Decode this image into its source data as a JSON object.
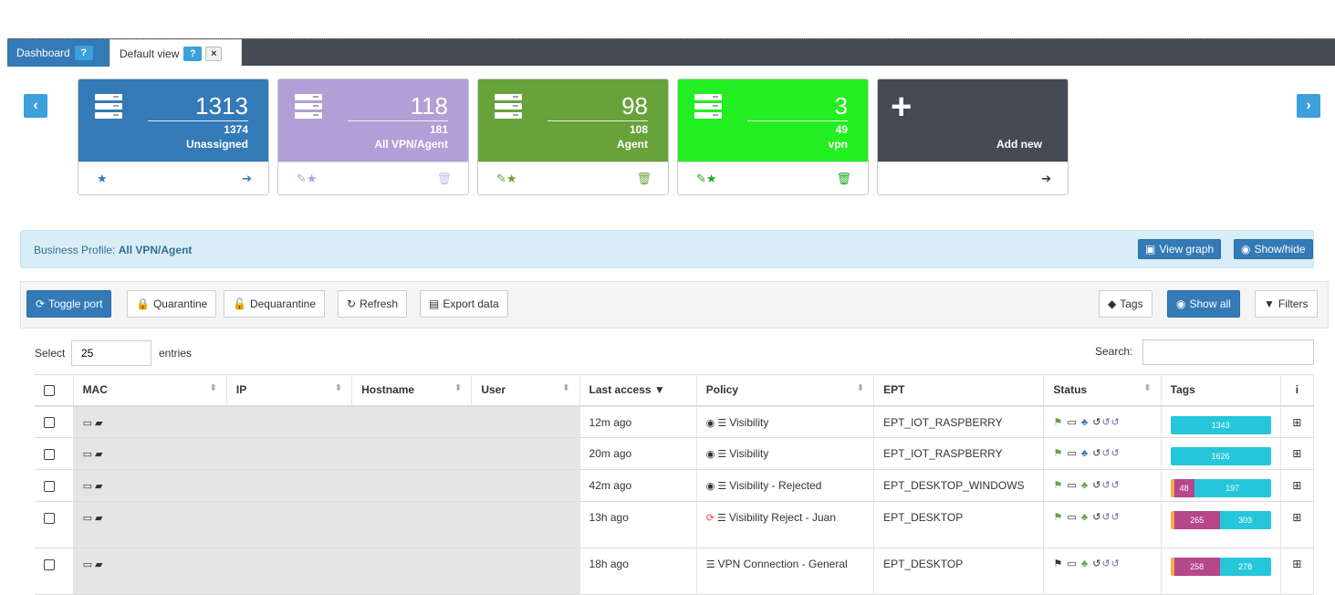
{
  "tabs": [
    {
      "label": "Dashboard",
      "help": "?"
    },
    {
      "label": "Default view",
      "help": "?",
      "close": "×"
    }
  ],
  "nav": {
    "prev": "‹",
    "next": "›"
  },
  "cards": [
    {
      "value": "1313",
      "total": "1374",
      "label": "Unassigned",
      "color": "#337ab7"
    },
    {
      "value": "118",
      "total": "181",
      "label": "All VPN/Agent",
      "color": "#b19fd6"
    },
    {
      "value": "98",
      "total": "108",
      "label": "Agent",
      "color": "#67a23a"
    },
    {
      "value": "3",
      "total": "49",
      "label": "vpn",
      "color": "#22ee22"
    }
  ],
  "add_card": {
    "label": "Add new",
    "color": "#444b55"
  },
  "profile": {
    "prefix": "Business Profile:",
    "name": "All VPN/Agent",
    "view_graph": "View graph",
    "show_hide": "Show/hide"
  },
  "toolbar": {
    "toggle_port": "Toggle port",
    "quarantine": "Quarantine",
    "dequarantine": "Dequarantine",
    "refresh": "Refresh",
    "export": "Export data",
    "tags": "Tags",
    "show_all": "Show all",
    "filters": "Filters"
  },
  "entries": {
    "select_label": "Select",
    "value": "25",
    "entries_label": "entries",
    "search_label": "Search:"
  },
  "table": {
    "columns": [
      "MAC",
      "IP",
      "Hostname",
      "User",
      "Last access",
      "Policy",
      "EPT",
      "Status",
      "Tags",
      "i"
    ],
    "rows": [
      {
        "last_access": "12m ago",
        "policy": "Visibility",
        "ept": "EPT_IOT_RASPBERRY",
        "tags": [
          "1343"
        ]
      },
      {
        "last_access": "20m ago",
        "policy": "Visibility",
        "ept": "EPT_IOT_RASPBERRY",
        "tags": [
          "1626"
        ]
      },
      {
        "last_access": "42m ago",
        "policy": "Visibility - Rejected",
        "ept": "EPT_DESKTOP_WINDOWS",
        "tags": [
          "48",
          "197"
        ]
      },
      {
        "last_access": "13h ago",
        "policy": "Visibility Reject - Juan",
        "ept": "EPT_DESKTOP",
        "tags": [
          "265",
          "303"
        ]
      },
      {
        "last_access": "18h ago",
        "policy": "VPN Connection - General",
        "ept": "EPT_DESKTOP",
        "tags": [
          "258",
          "278"
        ]
      }
    ]
  }
}
